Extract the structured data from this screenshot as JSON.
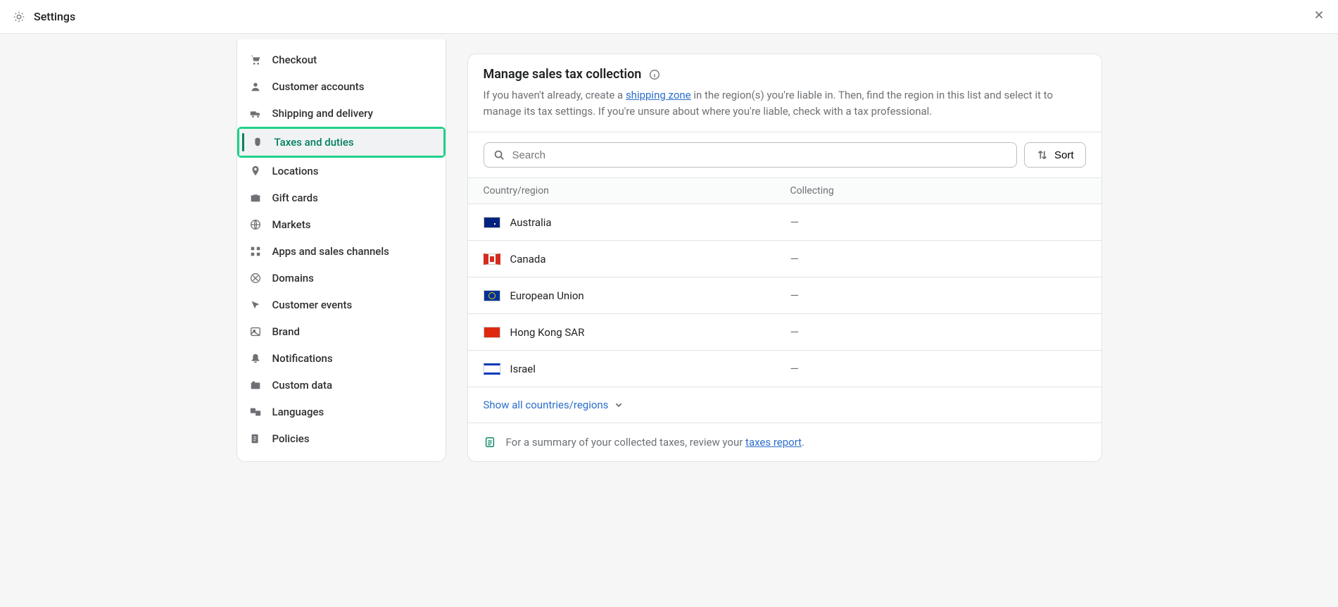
{
  "header": {
    "title": "Settings"
  },
  "sidebar": {
    "items": [
      {
        "label": "Checkout"
      },
      {
        "label": "Customer accounts"
      },
      {
        "label": "Shipping and delivery"
      },
      {
        "label": "Taxes and duties"
      },
      {
        "label": "Locations"
      },
      {
        "label": "Gift cards"
      },
      {
        "label": "Markets"
      },
      {
        "label": "Apps and sales channels"
      },
      {
        "label": "Domains"
      },
      {
        "label": "Customer events"
      },
      {
        "label": "Brand"
      },
      {
        "label": "Notifications"
      },
      {
        "label": "Custom data"
      },
      {
        "label": "Languages"
      },
      {
        "label": "Policies"
      }
    ]
  },
  "main": {
    "title": "Manage sales tax collection",
    "desc_before": "If you haven't already, create a ",
    "desc_link": "shipping zone",
    "desc_after": " in the region(s) you're liable in. Then, find the region in this list and select it to manage its tax settings. If you're unsure about where you're liable, check with a tax professional.",
    "search_placeholder": "Search",
    "sort_label": "Sort",
    "columns": {
      "country": "Country/region",
      "collecting": "Collecting"
    },
    "rows": [
      {
        "country": "Australia",
        "flag": "au",
        "collecting": "—"
      },
      {
        "country": "Canada",
        "flag": "ca",
        "collecting": "—"
      },
      {
        "country": "European Union",
        "flag": "eu",
        "collecting": "—"
      },
      {
        "country": "Hong Kong SAR",
        "flag": "hk",
        "collecting": "—"
      },
      {
        "country": "Israel",
        "flag": "il",
        "collecting": "—"
      }
    ],
    "show_all": "Show all countries/regions",
    "summary_before": "For a summary of your collected taxes, review your ",
    "summary_link": "taxes report",
    "summary_after": "."
  }
}
